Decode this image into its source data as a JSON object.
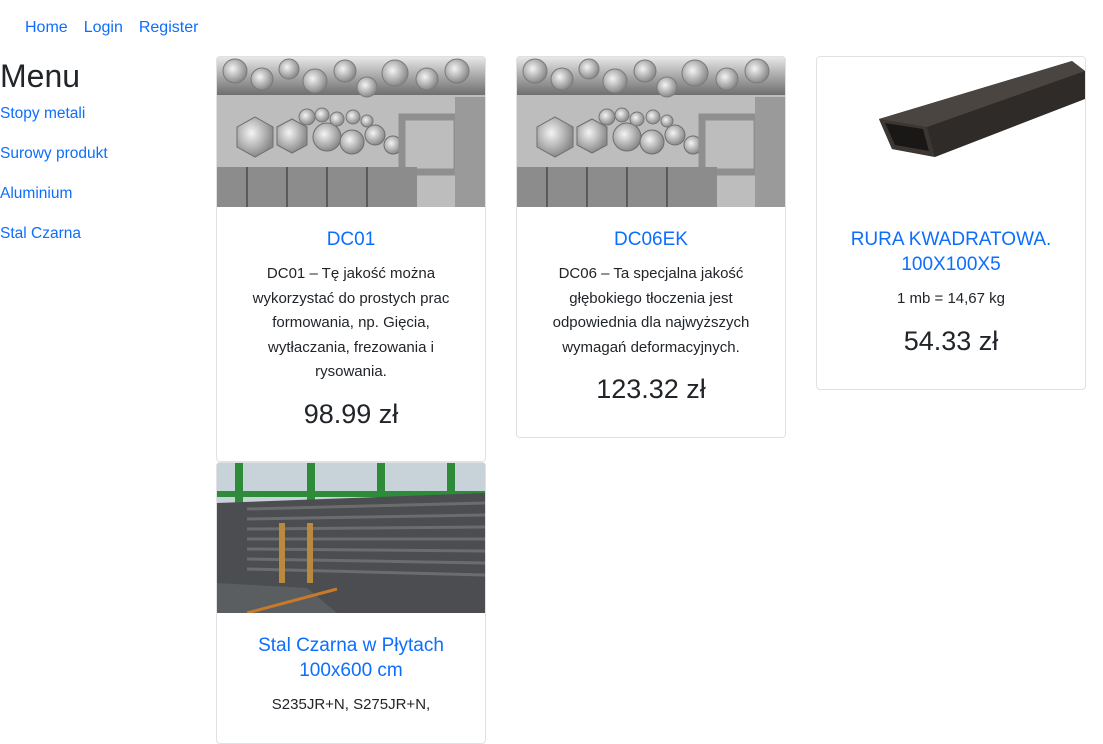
{
  "nav": {
    "home": "Home",
    "login": "Login",
    "register": "Register"
  },
  "sidebar": {
    "title": "Menu",
    "items": [
      {
        "label": "Stopy metali"
      },
      {
        "label": "Surowy produkt"
      },
      {
        "label": "Aluminium"
      },
      {
        "label": "Stal Czarna"
      }
    ]
  },
  "products": [
    {
      "title": "DC01",
      "description": "DC01 – Tę jakość można wykorzystać do prostych prac formowania, np. Gięcia, wytłaczania, frezowania i rysowania.",
      "price": "98.99 zł",
      "image": "aluminium-profiles-image"
    },
    {
      "title": "DC06EK",
      "description": "DC06 – Ta specjalna jakość głębokiego tłoczenia jest odpowiednia dla najwyższych wymagań deformacyjnych.",
      "price": "123.32 zł",
      "image": "aluminium-profiles-image"
    },
    {
      "title": "RURA KWADRATOWA. 100X100X5",
      "description": "1 mb = 14,67 kg",
      "price": "54.33 zł",
      "image": "square-tube-image"
    },
    {
      "title": "Stal Czarna w Płytach 100x600 cm",
      "description": "S235JR+N, S275JR+N,",
      "price": "",
      "image": "steel-plates-image"
    }
  ],
  "colors": {
    "link": "#0d6efd",
    "text": "#212529",
    "card_border": "#dfe1e4"
  }
}
